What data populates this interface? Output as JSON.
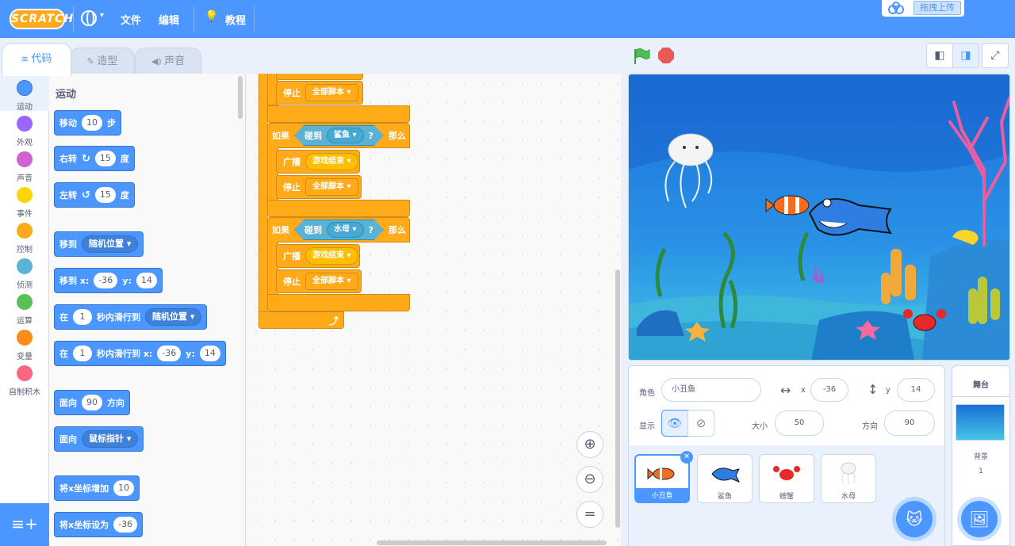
{
  "menu": {
    "logo": "SCRATCH",
    "lang": "",
    "file": "文件",
    "edit": "编辑",
    "tutorial": "教程",
    "upload": "拖拽上传"
  },
  "tabs": {
    "code": "代码",
    "costumes": "造型",
    "sounds": "声音"
  },
  "categories": [
    {
      "label": "运动",
      "color": "#4c97ff"
    },
    {
      "label": "外观",
      "color": "#9966ff"
    },
    {
      "label": "声音",
      "color": "#cf63cf"
    },
    {
      "label": "事件",
      "color": "#ffd500"
    },
    {
      "label": "控制",
      "color": "#ffab19"
    },
    {
      "label": "侦测",
      "color": "#5cb1d6"
    },
    {
      "label": "运算",
      "color": "#59c059"
    },
    {
      "label": "变量",
      "color": "#ff8c1a"
    },
    {
      "label": "自制积木",
      "color": "#ff6680"
    }
  ],
  "palette": {
    "title": "运动",
    "move": {
      "label": "移动",
      "value": "10",
      "unit": "步"
    },
    "turn_right": {
      "label": "右转",
      "value": "15",
      "unit": "度"
    },
    "turn_left": {
      "label": "左转",
      "value": "15",
      "unit": "度"
    },
    "goto": {
      "label": "移到",
      "option": "随机位置"
    },
    "goto_xy": {
      "label": "移到 x:",
      "x": "-36",
      "ylabel": "y:",
      "y": "14"
    },
    "glide": {
      "label": "在",
      "secs": "1",
      "text": "秒内滑行到",
      "option": "随机位置"
    },
    "glide_xy": {
      "label": "在",
      "secs": "1",
      "text": "秒内滑行到 x:",
      "x": "-36",
      "ylabel": "y:",
      "y": "14"
    },
    "point_dir": {
      "label": "面向",
      "value": "90",
      "unit": "方向"
    },
    "point_towards": {
      "label": "面向",
      "option": "鼠标指针"
    },
    "change_x": {
      "label": "将x坐标增加",
      "value": "10"
    },
    "set_x": {
      "label": "将x坐标设为",
      "value": "-36"
    }
  },
  "script": {
    "stop": "停止",
    "stop_option": "全部脚本",
    "if": "如果",
    "then": "那么",
    "touching": "碰到",
    "question": "?",
    "broadcast": "广播",
    "message": "游戏结束",
    "target1": "鲨鱼",
    "target2": "水母"
  },
  "sprite_info": {
    "sprite_label": "角色",
    "sprite_name": "小丑鱼",
    "x_label": "x",
    "x": "-36",
    "y_label": "y",
    "y": "14",
    "show_label": "显示",
    "size_label": "大小",
    "size": "50",
    "dir_label": "方向",
    "dir": "90"
  },
  "sprites": [
    {
      "name": "小丑鱼",
      "selected": true
    },
    {
      "name": "鲨鱼",
      "selected": false
    },
    {
      "name": "螃蟹",
      "selected": false
    },
    {
      "name": "水母",
      "selected": false
    }
  ],
  "stage_panel": {
    "title": "舞台",
    "backdrops_label": "背景",
    "backdrops_count": "1"
  }
}
